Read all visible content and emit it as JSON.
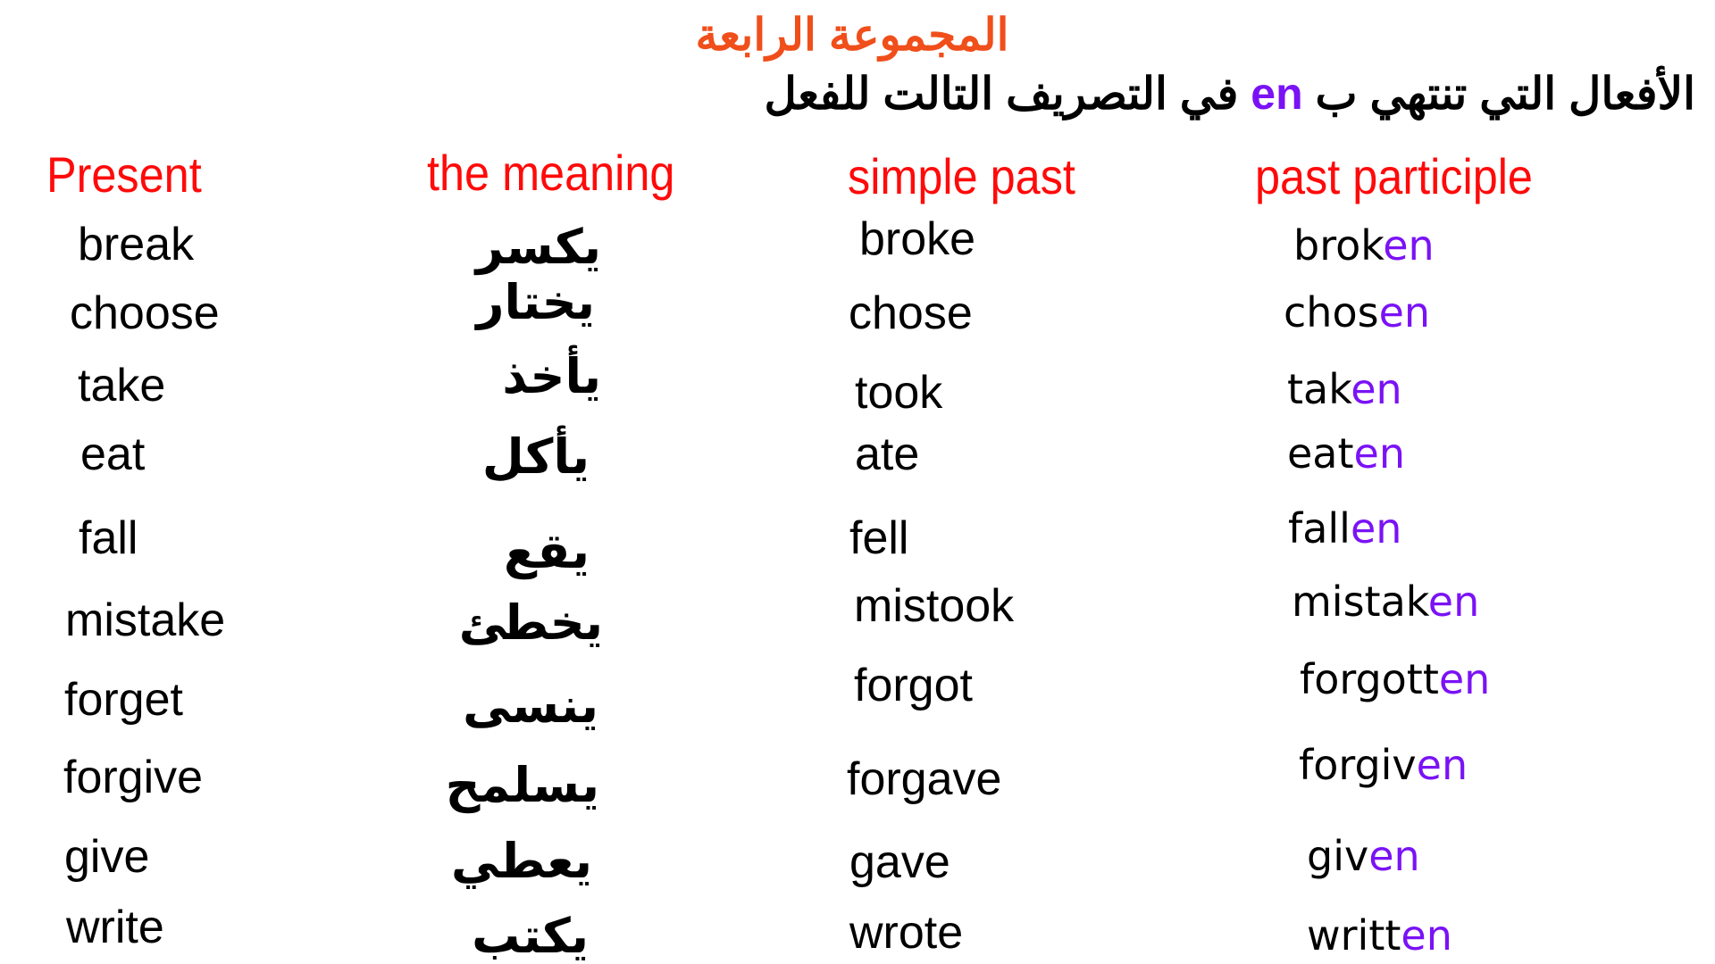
{
  "title": "المجموعة الرابعة",
  "subtitle": {
    "before": "الأفعال التي تنتهي ب",
    "highlight": "en",
    "after": "في التصريف التالت للفعل"
  },
  "colors": {
    "title": "#f04e1a",
    "headers": "#ff0a0a",
    "highlight": "#7a12f5",
    "text": "#000000"
  },
  "headers": {
    "present": "Present",
    "meaning": "the meaning",
    "simple_past": "simple past",
    "past_participle": "past participle"
  },
  "rows": [
    {
      "present": "break",
      "meaning": "يكسر",
      "simple_past": "broke",
      "pp_stem": "brok",
      "pp_suffix": "en"
    },
    {
      "present": "choose",
      "meaning": "يختار",
      "simple_past": "chose",
      "pp_stem": "chos",
      "pp_suffix": "en"
    },
    {
      "present": "take",
      "meaning": "يأخذ",
      "simple_past": "took",
      "pp_stem": "tak",
      "pp_suffix": "en"
    },
    {
      "present": "eat",
      "meaning": "يأكل",
      "simple_past": "ate",
      "pp_stem": "eat",
      "pp_suffix": "en"
    },
    {
      "present": "fall",
      "meaning": "يقع",
      "simple_past": "fell",
      "pp_stem": "fall",
      "pp_suffix": "en"
    },
    {
      "present": "mistake",
      "meaning": "يخطئ",
      "simple_past": "mistook",
      "pp_stem": "mistak",
      "pp_suffix": "en"
    },
    {
      "present": "forget",
      "meaning": "ينسى",
      "simple_past": "forgot",
      "pp_stem": "forgott",
      "pp_suffix": "en"
    },
    {
      "present": "forgive",
      "meaning": "يسلمح",
      "simple_past": "forgave",
      "pp_stem": "forgiv",
      "pp_suffix": "en"
    },
    {
      "present": "give",
      "meaning": "يعطي",
      "simple_past": "gave",
      "pp_stem": "giv",
      "pp_suffix": "en"
    },
    {
      "present": "write",
      "meaning": "يكتب",
      "simple_past": "wrote",
      "pp_stem": "writt",
      "pp_suffix": "en"
    }
  ]
}
